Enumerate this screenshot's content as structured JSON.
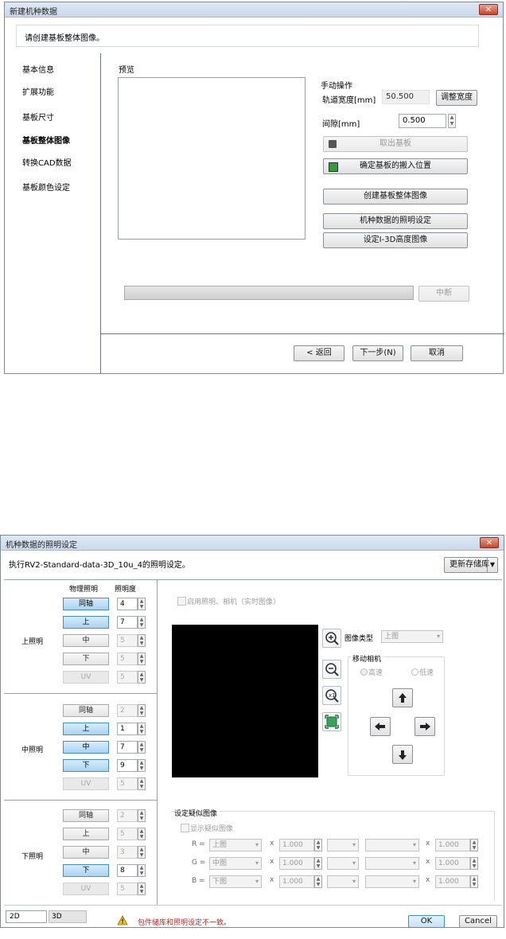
{
  "dialog1": {
    "title": "新建机种数据",
    "instruction": "请创建基板整体图像。",
    "nav": [
      "基本信息",
      "扩展功能",
      "基板尺寸",
      "基板整体图像",
      "转换CAD数据",
      "基板颜色设定"
    ],
    "preview_label": "预览",
    "manual_group": "手动操作",
    "rail_width_label": "轨道宽度[mm]",
    "rail_width_value": "50.500",
    "adjust_width_btn": "调整宽度",
    "gap_label": "间隙[mm]",
    "gap_value": "0.500",
    "eject_btn": "取出基板",
    "confirm_pos_btn": "确定基板的搬入位置",
    "create_image_btn": "创建基板整体图像",
    "lighting_btn": "机种数据的照明设定",
    "height_image_btn": "设定I-3D高度图像",
    "stop_btn": "中断",
    "back_btn": "< 返回",
    "next_btn": "下一步(N)",
    "cancel_btn": "取消",
    "close_glyph": "✕"
  },
  "dialog2": {
    "title": "机种数据的照明设定",
    "exec_text": "执行RV2-Standard-data-3D_10u_4的照明设定。",
    "update_lib_btn": "更新存储库",
    "col_physical": "物理照明",
    "col_brightness": "照明度",
    "groups": [
      {
        "label": "上照明",
        "rows": [
          {
            "name": "同轴",
            "state": "on",
            "value": "4"
          },
          {
            "name": "上",
            "state": "on",
            "value": "7"
          },
          {
            "name": "中",
            "state": "off",
            "value": "5"
          },
          {
            "name": "下",
            "state": "off",
            "value": "5"
          },
          {
            "name": "UV",
            "state": "dis",
            "value": "5"
          }
        ]
      },
      {
        "label": "中照明",
        "rows": [
          {
            "name": "同轴",
            "state": "off",
            "value": "2"
          },
          {
            "name": "上",
            "state": "on",
            "value": "1"
          },
          {
            "name": "中",
            "state": "on",
            "value": "7"
          },
          {
            "name": "下",
            "state": "on",
            "value": "9"
          },
          {
            "name": "UV",
            "state": "dis",
            "value": "5"
          }
        ]
      },
      {
        "label": "下照明",
        "rows": [
          {
            "name": "同轴",
            "state": "off",
            "value": "2"
          },
          {
            "name": "上",
            "state": "off",
            "value": "5"
          },
          {
            "name": "中",
            "state": "off",
            "value": "3"
          },
          {
            "name": "下",
            "state": "on",
            "value": "8"
          },
          {
            "name": "UV",
            "state": "dis",
            "value": "5"
          }
        ]
      }
    ],
    "enable_camera_label": "启用照明、相机（实时图像）",
    "image_type_label": "图像类型",
    "image_type_value": "上图",
    "move_camera_label": "移动相机",
    "speed_high": "高速",
    "speed_low": "低速",
    "pseudo_group": "设定疑似图像",
    "show_pseudo_label": "显示疑似图像",
    "rgb_rows": [
      {
        "ch": "R =",
        "src": "上图",
        "mul": "1.000",
        "mul2": "1.000"
      },
      {
        "ch": "G =",
        "src": "中图",
        "mul": "1.000",
        "mul2": "1.000"
      },
      {
        "ch": "B =",
        "src": "下图",
        "mul": "1.000",
        "mul2": "1.000"
      }
    ],
    "times": "x",
    "tab_2d": "2D",
    "tab_3d": "3D",
    "warning_text": "包件储库和照明设定不一致。",
    "ok_btn": "OK",
    "cancel_btn": "Cancel",
    "close_glyph": "✕"
  },
  "colors": {
    "accent_blue": "#3f8fd1",
    "warning_red": "#d02020",
    "title_bar": "#c9d8ea"
  }
}
